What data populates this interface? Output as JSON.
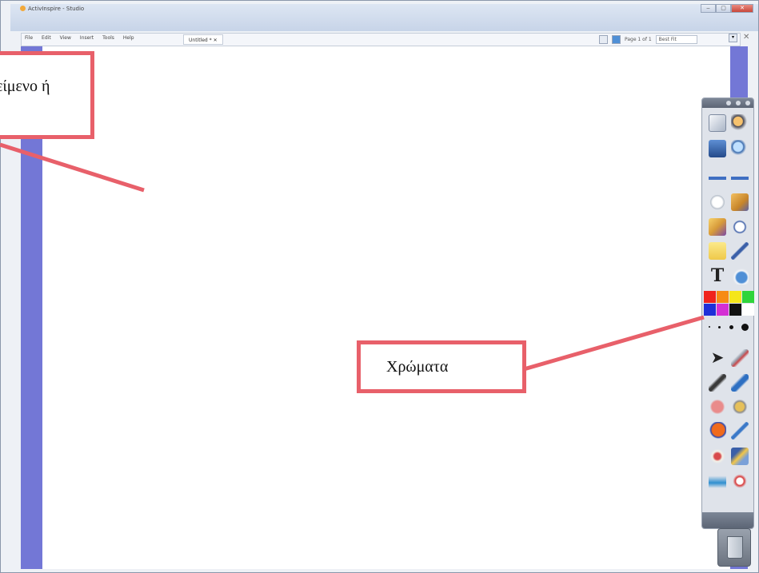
{
  "window": {
    "title": "ActivInspire - Studio"
  },
  "menubar": {
    "items": [
      "File",
      "Edit",
      "View",
      "Insert",
      "Tools",
      "Help"
    ],
    "tab_label": "Untitled *",
    "page_indicator": "Page 1 of 1",
    "zoom_value": "Best Fit"
  },
  "callouts": {
    "text_tool_label": "είμενο ή",
    "colors_label": "Χρώματα"
  },
  "palette": {
    "colors": [
      "#f0241c",
      "#f78b13",
      "#f5e61a",
      "#2fd43b",
      "#1e2fd8",
      "#d42fd4",
      "#111111",
      "#ffffff"
    ]
  },
  "icons": {
    "tools": [
      "page-browser-icon",
      "user-icon",
      "photo-icon",
      "magnifier-icon",
      "previous-page-icon",
      "next-page-icon",
      "clock-dial-icon",
      "edit-icon",
      "check-pencil-icon",
      "clock-icon",
      "sticky-note-icon",
      "pen-icon",
      "text-icon",
      "paint-icon",
      "select-icon",
      "erase-tool-icon",
      "pen-tool-icon",
      "marker-icon",
      "eraser-icon",
      "fill-icon",
      "shape-icon",
      "connector-icon",
      "magic-ink-icon",
      "grid-icon",
      "spray-icon",
      "refresh-icon"
    ]
  }
}
